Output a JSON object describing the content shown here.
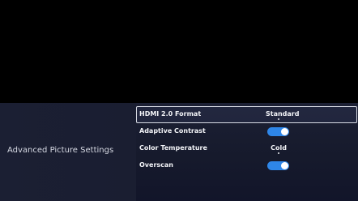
{
  "screen": {
    "section_title": "Advanced Picture Settings"
  },
  "menu": {
    "items": [
      {
        "label": "HDMI 2.0 Format",
        "type": "value",
        "value": "Standard",
        "focused": true
      },
      {
        "label": "Adaptive Contrast",
        "type": "toggle",
        "state": "on"
      },
      {
        "label": "Color Temperature",
        "type": "value",
        "value": "Cold"
      },
      {
        "label": "Overscan",
        "type": "toggle",
        "state": "on"
      }
    ]
  },
  "colors": {
    "toggle_on": "#2e86e8",
    "panel_background": "#1c2034",
    "focus_border": "#d8dbe4"
  }
}
